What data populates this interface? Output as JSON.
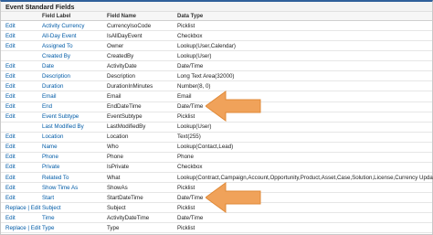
{
  "panel": {
    "title": "Event Standard Fields"
  },
  "columns": {
    "action": "",
    "field_label": "Field Label",
    "field_name": "Field Name",
    "data_type": "Data Type"
  },
  "rows": [
    {
      "action": "Edit",
      "label": "Activity Currency",
      "name": "CurrencyIsoCode",
      "type": "Picklist"
    },
    {
      "action": "Edit",
      "label": "All-Day Event",
      "name": "IsAllDayEvent",
      "type": "Checkbox"
    },
    {
      "action": "Edit",
      "label": "Assigned To",
      "name": "Owner",
      "type": "Lookup(User,Calendar)"
    },
    {
      "action": "",
      "label": "Created By",
      "name": "CreatedBy",
      "type": "Lookup(User)"
    },
    {
      "action": "Edit",
      "label": "Date",
      "name": "ActivityDate",
      "type": "Date/Time"
    },
    {
      "action": "Edit",
      "label": "Description",
      "name": "Description",
      "type": "Long Text Area(32000)"
    },
    {
      "action": "Edit",
      "label": "Duration",
      "name": "DurationInMinutes",
      "type": "Number(8, 0)"
    },
    {
      "action": "Edit",
      "label": "Email",
      "name": "Email",
      "type": "Email"
    },
    {
      "action": "Edit",
      "label": "End",
      "name": "EndDateTime",
      "type": "Date/Time"
    },
    {
      "action": "Edit",
      "label": "Event Subtype",
      "name": "EventSubtype",
      "type": "Picklist"
    },
    {
      "action": "",
      "label": "Last Modified By",
      "name": "LastModifiedBy",
      "type": "Lookup(User)"
    },
    {
      "action": "Edit",
      "label": "Location",
      "name": "Location",
      "type": "Text(255)"
    },
    {
      "action": "Edit",
      "label": "Name",
      "name": "Who",
      "type": "Lookup(Contact,Lead)"
    },
    {
      "action": "Edit",
      "label": "Phone",
      "name": "Phone",
      "type": "Phone"
    },
    {
      "action": "Edit",
      "label": "Private",
      "name": "IsPrivate",
      "type": "Checkbox"
    },
    {
      "action": "Edit",
      "label": "Related To",
      "name": "What",
      "type": "Lookup(Contract,Campaign,Account,Opportunity,Product,Asset,Case,Solution,License,Currency Updater Job)"
    },
    {
      "action": "Edit",
      "label": "Show Time As",
      "name": "ShowAs",
      "type": "Picklist"
    },
    {
      "action": "Edit",
      "label": "Start",
      "name": "StartDateTime",
      "type": "Date/Time"
    },
    {
      "action": "Replace | Edit",
      "label": "Subject",
      "name": "Subject",
      "type": "Picklist"
    },
    {
      "action": "Edit",
      "label": "Time",
      "name": "ActivityDateTime",
      "type": "Date/Time"
    },
    {
      "action": "Replace | Edit",
      "label": "Type",
      "name": "Type",
      "type": "Picklist"
    }
  ],
  "colors": {
    "link": "#015ba7",
    "arrow": "#f0a25a",
    "header_border": "#2f5f9a"
  }
}
